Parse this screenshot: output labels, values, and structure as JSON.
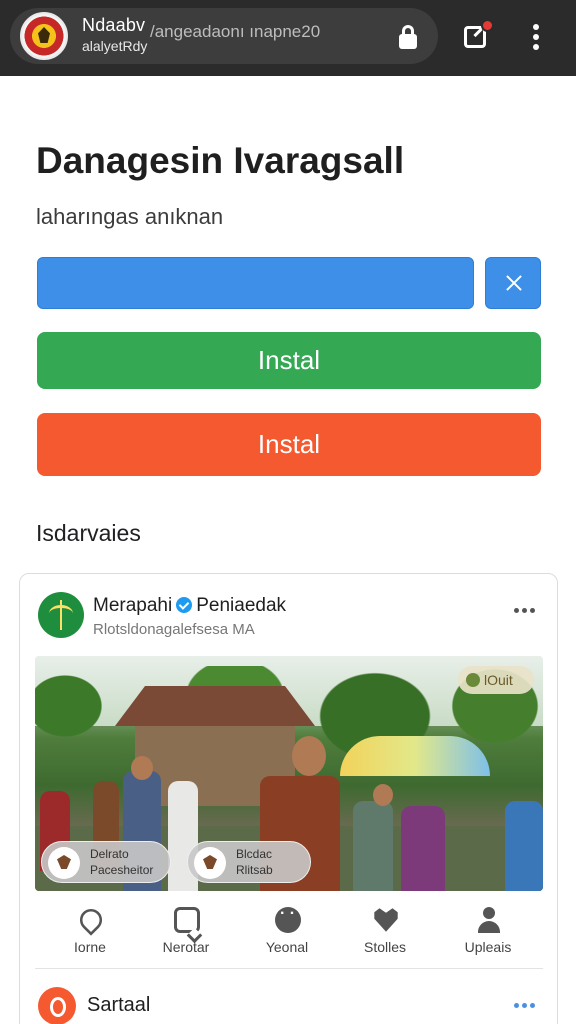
{
  "browser": {
    "site_title": "Ndaabv",
    "site_subtitle": "alalyetRdy",
    "url": "/angeadaonı ınapne20"
  },
  "page": {
    "title": "Danagesin Ivaragsall",
    "subtitle": "laharıngas anıknan"
  },
  "buttons": {
    "green_label": "Instal",
    "orange_label": "Instal"
  },
  "section": {
    "label": "Isdarvaies"
  },
  "post": {
    "author": "Merapahi",
    "author_suffix": "Peniaedak",
    "author_sub": "Rlotsldonagalefsesa MA",
    "photo_tag": "lOuit",
    "chips": [
      {
        "line1": "Delrato",
        "line2": "Pacesheitor"
      },
      {
        "line1": "Blcdac",
        "line2": "Rlitsab"
      }
    ],
    "actions": [
      {
        "label": "Iorne",
        "icon": "home-icon"
      },
      {
        "label": "Nerotar",
        "icon": "chat-icon"
      },
      {
        "label": "Yeonal",
        "icon": "dots-icon"
      },
      {
        "label": "Stolles",
        "icon": "heart-icon"
      },
      {
        "label": "Upleais",
        "icon": "user-icon"
      }
    ]
  },
  "post2": {
    "author": "Sartaal"
  },
  "colors": {
    "topbar": "#2b2b2b",
    "blue": "#3d8fe8",
    "green": "#34a853",
    "orange": "#f4592f",
    "verified": "#1d9bf0"
  }
}
